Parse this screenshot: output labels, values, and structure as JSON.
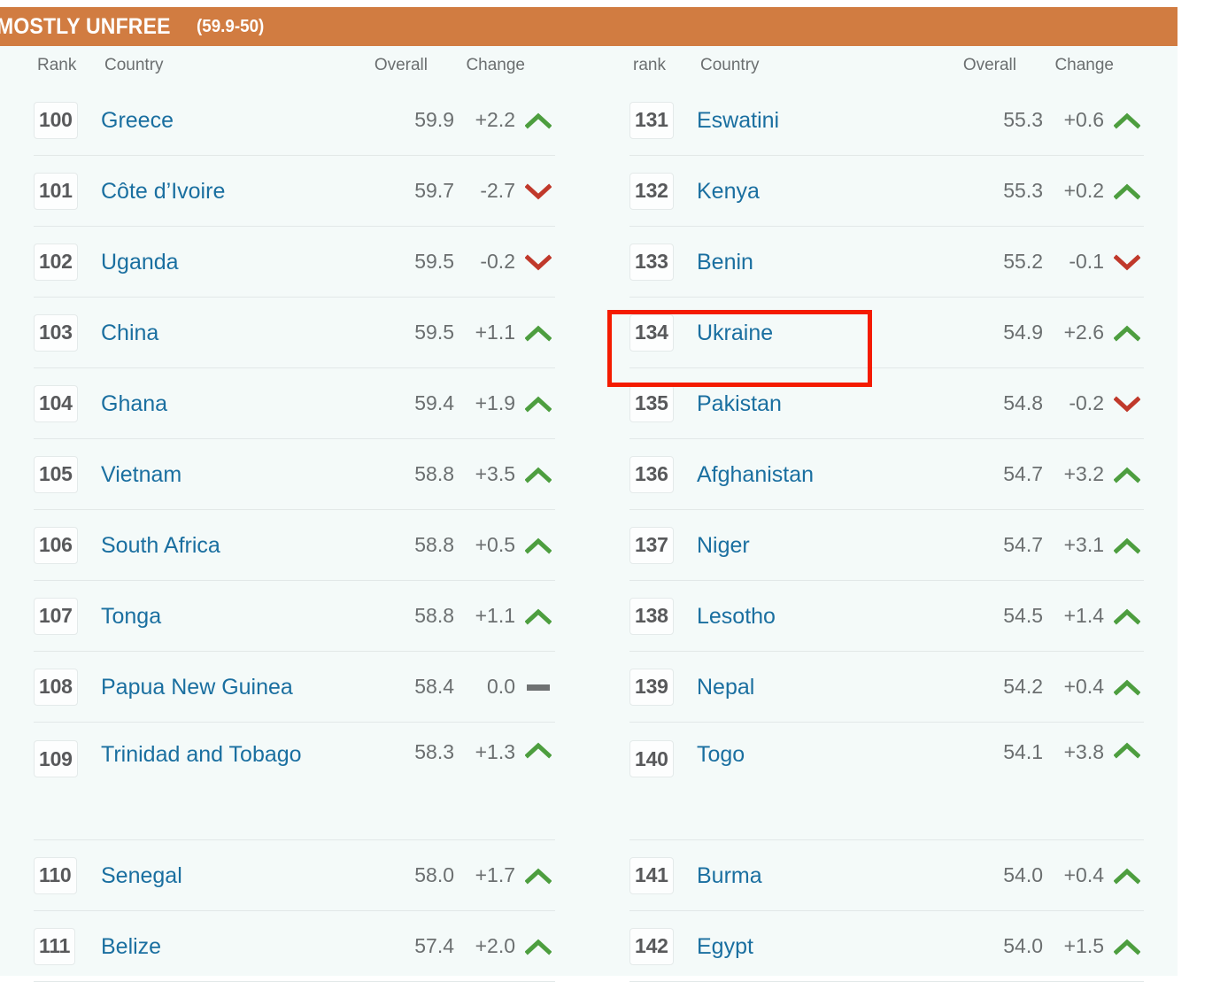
{
  "banner": {
    "title": "MOSTLY UNFREE",
    "range": "(59.9-50)",
    "color": "#d17c41"
  },
  "colors": {
    "background": "#f4faf9",
    "country_link": "#1a6fa0",
    "value_text": "#6b6f70",
    "rank_text": "#58595b",
    "up_arrow": "#4d9e3f",
    "down_arrow": "#c0392b",
    "flat_bar": "#6f7273",
    "annotation": "#f41b00"
  },
  "columns": [
    {
      "headers": {
        "rank": "Rank",
        "country": "Country",
        "overall": "Overall",
        "change": "Change"
      },
      "rows": [
        {
          "rank": "100",
          "country": "Greece",
          "overall": "59.9",
          "change": "+2.2",
          "trend": "up",
          "tall": false
        },
        {
          "rank": "101",
          "country": "Côte d’Ivoire",
          "overall": "59.7",
          "change": "-2.7",
          "trend": "down",
          "tall": false
        },
        {
          "rank": "102",
          "country": "Uganda",
          "overall": "59.5",
          "change": "-0.2",
          "trend": "down",
          "tall": false
        },
        {
          "rank": "103",
          "country": "China",
          "overall": "59.5",
          "change": "+1.1",
          "trend": "up",
          "tall": false
        },
        {
          "rank": "104",
          "country": "Ghana",
          "overall": "59.4",
          "change": "+1.9",
          "trend": "up",
          "tall": false
        },
        {
          "rank": "105",
          "country": "Vietnam",
          "overall": "58.8",
          "change": "+3.5",
          "trend": "up",
          "tall": false
        },
        {
          "rank": "106",
          "country": "South Africa",
          "overall": "58.8",
          "change": "+0.5",
          "trend": "up",
          "tall": false
        },
        {
          "rank": "107",
          "country": "Tonga",
          "overall": "58.8",
          "change": "+1.1",
          "trend": "up",
          "tall": false
        },
        {
          "rank": "108",
          "country": "Papua New Guinea",
          "overall": "58.4",
          "change": "0.0",
          "trend": "flat",
          "tall": false
        },
        {
          "rank": "109",
          "country": "Trinidad and Tobago",
          "overall": "58.3",
          "change": "+1.3",
          "trend": "up",
          "tall": true
        },
        {
          "rank": "110",
          "country": "Senegal",
          "overall": "58.0",
          "change": "+1.7",
          "trend": "up",
          "tall": false
        },
        {
          "rank": "111",
          "country": "Belize",
          "overall": "57.4",
          "change": "+2.0",
          "trend": "up",
          "tall": false
        }
      ]
    },
    {
      "headers": {
        "rank": "rank",
        "country": "Country",
        "overall": "Overall",
        "change": "Change"
      },
      "rows": [
        {
          "rank": "131",
          "country": "Eswatini",
          "overall": "55.3",
          "change": "+0.6",
          "trend": "up",
          "tall": false
        },
        {
          "rank": "132",
          "country": "Kenya",
          "overall": "55.3",
          "change": "+0.2",
          "trend": "up",
          "tall": false
        },
        {
          "rank": "133",
          "country": "Benin",
          "overall": "55.2",
          "change": "-0.1",
          "trend": "down",
          "tall": false
        },
        {
          "rank": "134",
          "country": "Ukraine",
          "overall": "54.9",
          "change": "+2.6",
          "trend": "up",
          "tall": false
        },
        {
          "rank": "135",
          "country": "Pakistan",
          "overall": "54.8",
          "change": "-0.2",
          "trend": "down",
          "tall": false
        },
        {
          "rank": "136",
          "country": "Afghanistan",
          "overall": "54.7",
          "change": "+3.2",
          "trend": "up",
          "tall": false
        },
        {
          "rank": "137",
          "country": "Niger",
          "overall": "54.7",
          "change": "+3.1",
          "trend": "up",
          "tall": false
        },
        {
          "rank": "138",
          "country": "Lesotho",
          "overall": "54.5",
          "change": "+1.4",
          "trend": "up",
          "tall": false
        },
        {
          "rank": "139",
          "country": "Nepal",
          "overall": "54.2",
          "change": "+0.4",
          "trend": "up",
          "tall": false
        },
        {
          "rank": "140",
          "country": "Togo",
          "overall": "54.1",
          "change": "+3.8",
          "trend": "up",
          "tall": true
        },
        {
          "rank": "141",
          "country": "Burma",
          "overall": "54.0",
          "change": "+0.4",
          "trend": "up",
          "tall": false
        },
        {
          "rank": "142",
          "country": "Egypt",
          "overall": "54.0",
          "change": "+1.5",
          "trend": "up",
          "tall": false
        }
      ]
    }
  ],
  "annotation": {
    "target_rank": "134",
    "target_country": "Ukraine"
  }
}
